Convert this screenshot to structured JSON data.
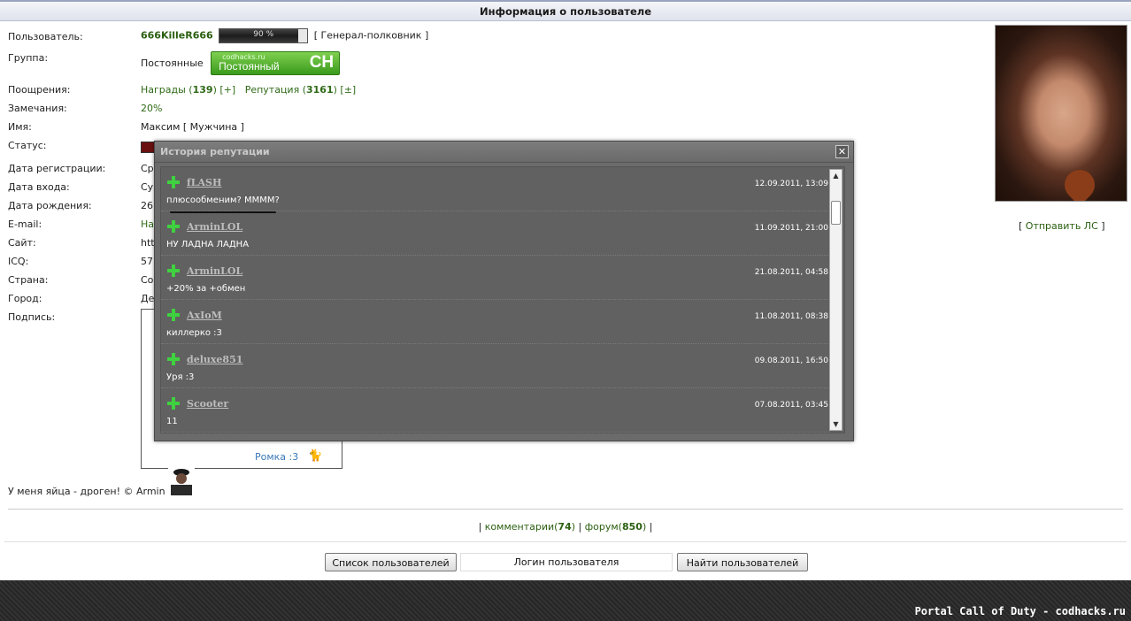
{
  "header": {
    "title": "Информация о пользователе"
  },
  "profile": {
    "labels": {
      "user": "Пользователь:",
      "group": "Группа:",
      "rewards": "Поощрения:",
      "warnings": "Замечания:",
      "name": "Имя:",
      "status": "Статус:",
      "reg_date": "Дата регистрации:",
      "login_date": "Дата входа:",
      "birth_date": "Дата рождения:",
      "email": "E-mail:",
      "site": "Сайт:",
      "icq": "ICQ:",
      "country": "Страна:",
      "city": "Город:",
      "signature": "Подпись:"
    },
    "username": "666KilleR666",
    "progress": {
      "text": "90 %",
      "value": 0.9
    },
    "rank": "[ Генерал-полковник ]",
    "group_name": "Постоянные",
    "badge": {
      "site": "codhacks.ru",
      "text": "Постоянный",
      "logo": "CH"
    },
    "awards_label": "Награды",
    "awards_count": "139",
    "awards_add": "[+]",
    "reputation_label": "Репутация",
    "reputation_count": "3161",
    "reputation_change": "[±]",
    "warnings_value": "20%",
    "name_value": "Максим",
    "gender": "[ Мужчина ]",
    "reg_date_partial": "Ср",
    "login_date_partial": "Су",
    "birth_date_partial": "26",
    "email_partial": "На",
    "site_partial": "htt",
    "icq_partial": "57",
    "country_partial": "Со",
    "city_partial": "Де"
  },
  "signature": {
    "romka": "Ромка :3",
    "quote": "У меня яйца - дроген! © Armin"
  },
  "send_pm": {
    "open": "[ ",
    "link": "Отправить ЛС",
    "close": " ]"
  },
  "links": {
    "comments_label": "комментарии",
    "comments_count": "74",
    "forum_label": "форум",
    "forum_count": "850"
  },
  "search": {
    "list_button": "Список пользователей",
    "input_value": "Логин пользователя",
    "find_button": "Найти пользователей"
  },
  "footer": {
    "text": "Portal Call of Duty - codhacks.ru"
  },
  "modal": {
    "title": "История репутации",
    "close": "✕",
    "items": [
      {
        "name": "fLASH",
        "date": "12.09.2011, 13:09",
        "text": "плюсообменим? ММММ?"
      },
      {
        "name": "ArminLOL",
        "date": "11.09.2011, 21:00",
        "text": "НУ ЛАДНА ЛАДНА"
      },
      {
        "name": "ArminLOL",
        "date": "21.08.2011, 04:58",
        "text": "+20% за +обмен"
      },
      {
        "name": "AxIoM",
        "date": "11.08.2011, 08:38",
        "text": "киллерко :3"
      },
      {
        "name": "deluxe851",
        "date": "09.08.2011, 16:50",
        "text": "Уря :3"
      },
      {
        "name": "Scooter",
        "date": "07.08.2011, 03:45",
        "text": "11"
      }
    ]
  },
  "icons": {
    "plus": "plus-icon",
    "close": "close-icon",
    "cat": "cat-icon"
  },
  "colors": {
    "link_green": "#2b5f10",
    "modal_bg": "#6b6b6b",
    "plus_green": "#3fd13f"
  }
}
